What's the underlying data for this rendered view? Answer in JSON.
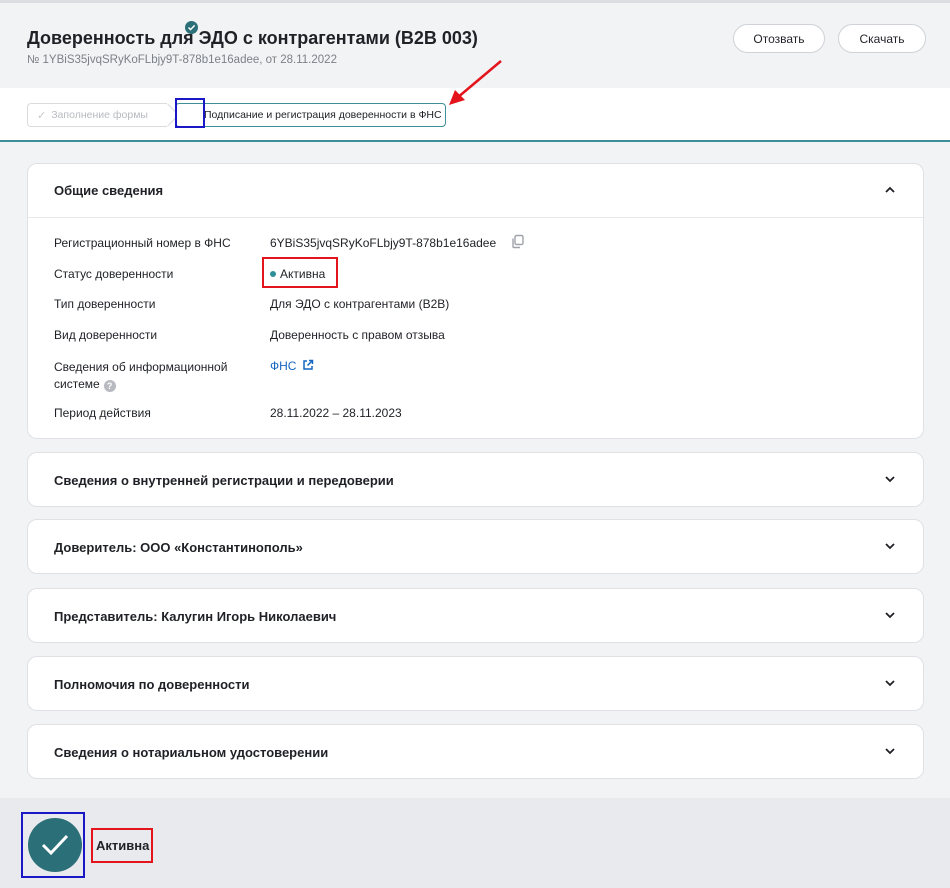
{
  "header": {
    "title": "Доверенность для ЭДО с контрагентами (B2B 003)",
    "subtitle": "№ 1YBiS35jvqSRyKoFLbjy9T-878b1e16adee, от 28.11.2022",
    "revoke_label": "Отозвать",
    "download_label": "Скачать"
  },
  "steps": {
    "step1": "Заполнение формы",
    "step2": "Подписание и регистрация доверенности в ФНС"
  },
  "general": {
    "title": "Общие сведения",
    "fields": [
      {
        "label": "Регистрационный номер в ФНС",
        "value": "6YBiS35jvqSRyKoFLbjy9T-878b1e16adee"
      },
      {
        "label": "Статус доверенности",
        "value": "Активна"
      },
      {
        "label": "Тип доверенности",
        "value": "Для ЭДО с контрагентами (B2B)"
      },
      {
        "label": "Вид доверенности",
        "value": "Доверенность с правом отзыва"
      },
      {
        "label_line1": "Сведения об информационной",
        "label_line2": "системе",
        "value": "ФНС"
      },
      {
        "label": "Период действия",
        "value": "28.11.2022 – 28.11.2023"
      }
    ]
  },
  "sections": [
    "Сведения о внутренней регистрации и передоверии",
    "Доверитель: ООО «Константинополь»",
    "Представитель: Калугин Игорь Николаевич",
    "Полномочия по доверенности",
    "Сведения о нотариальном удостоверении"
  ],
  "bottom": {
    "status": "Активна"
  },
  "colors": {
    "accent": "#2b6f78",
    "link": "#1565c0",
    "annotation_red": "#e3141c",
    "annotation_blue": "#1a17c7"
  }
}
